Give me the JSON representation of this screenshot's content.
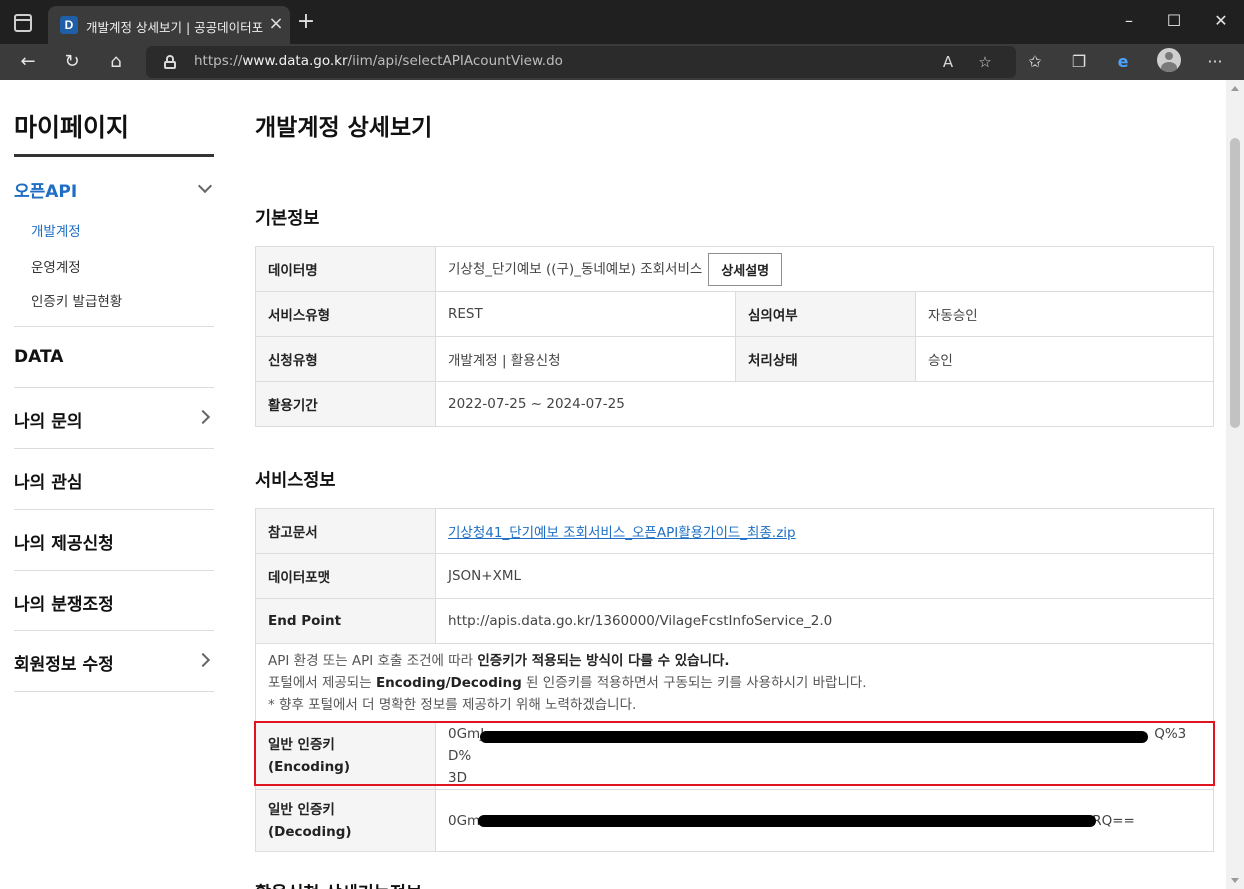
{
  "browser": {
    "tab_title": "개발계정 상세보기 | 공공데이터포털",
    "favicon_letter": "D",
    "url_prefix": "https://",
    "url_host": "www.data.go.kr",
    "url_path": "/iim/api/selectAPIAcountView.do",
    "icons": [
      "tab-actions-icon",
      "close-icon",
      "plus-icon",
      "minimize-icon",
      "maximize-icon",
      "close-window-icon",
      "back-icon",
      "refresh-icon",
      "home-icon",
      "lock-icon",
      "read-aloud-icon",
      "favorite-add-icon",
      "favorites-icon",
      "collections-icon",
      "edge-icon",
      "profile-icon",
      "more-icon"
    ]
  },
  "sidebar": {
    "title": "마이페이지",
    "sections": [
      {
        "label": "오픈API",
        "active": true,
        "sub": [
          {
            "label": "개발계정",
            "active": true
          },
          {
            "label": "운영계정"
          },
          {
            "label": "인증키 발급현황"
          }
        ]
      },
      {
        "label": "DATA"
      },
      {
        "label": "나의 문의"
      },
      {
        "label": "나의 관심"
      },
      {
        "label": "나의 제공신청"
      },
      {
        "label": "나의 분쟁조정"
      },
      {
        "label": "회원정보 수정"
      }
    ]
  },
  "main": {
    "title": "개발계정 상세보기",
    "basic": {
      "heading": "기본정보",
      "data_name_label": "데이터명",
      "data_name_value": "기상청_단기예보 ((구)_동네예보) 조회서비스",
      "detail_button": "상세설명",
      "service_type_label": "서비스유형",
      "service_type_value": "REST",
      "review_label": "심의여부",
      "review_value": "자동승인",
      "apply_type_label": "신청유형",
      "apply_type_value": "개발계정 | 활용신청",
      "status_label": "처리상태",
      "status_value": "승인",
      "period_label": "활용기간",
      "period_value": "2022-07-25 ~ 2024-07-25"
    },
    "service": {
      "heading": "서비스정보",
      "ref_doc_label": "참고문서",
      "ref_doc_value": "기상청41_단기예보 조회서비스_오픈API활용가이드_최종.zip",
      "format_label": "데이터포맷",
      "format_value": "JSON+XML",
      "endpoint_label": "End Point",
      "endpoint_value": "http://apis.data.go.kr/1360000/VilageFcstInfoService_2.0",
      "notice_1a": "API 환경 또는 API 호출 조건에 따라 ",
      "notice_1b": "인증키가 적용되는 방식이 다를 수 있습니다.",
      "notice_2a": "포털에서 제공되는 ",
      "notice_2b": "Encoding/Decoding",
      "notice_2c": " 된 인증키를 적용하면서 구동되는 키를 사용하시기 바랍니다.",
      "notice_3": "* 향후 포털에서 더 명확한 정보를 제공하기 위해 노력하겠습니다.",
      "enc_label_1": "일반 인증키",
      "enc_label_2": "(Encoding)",
      "enc_value_start": "0GmJ",
      "enc_value_end": "Q%3D%",
      "enc_value_line2": "3D",
      "dec_label_1": "일반 인증키",
      "dec_label_2": "(Decoding)",
      "dec_value_start": "0Gm",
      "dec_value_end": "RQ=="
    },
    "next_heading": "활용신청 상세기능정보"
  },
  "colors": {
    "accent": "#1e6fc4",
    "highlight": "#e0141e",
    "chrome_dark": "#202020",
    "chrome_toolbar": "#3b3b3b"
  }
}
